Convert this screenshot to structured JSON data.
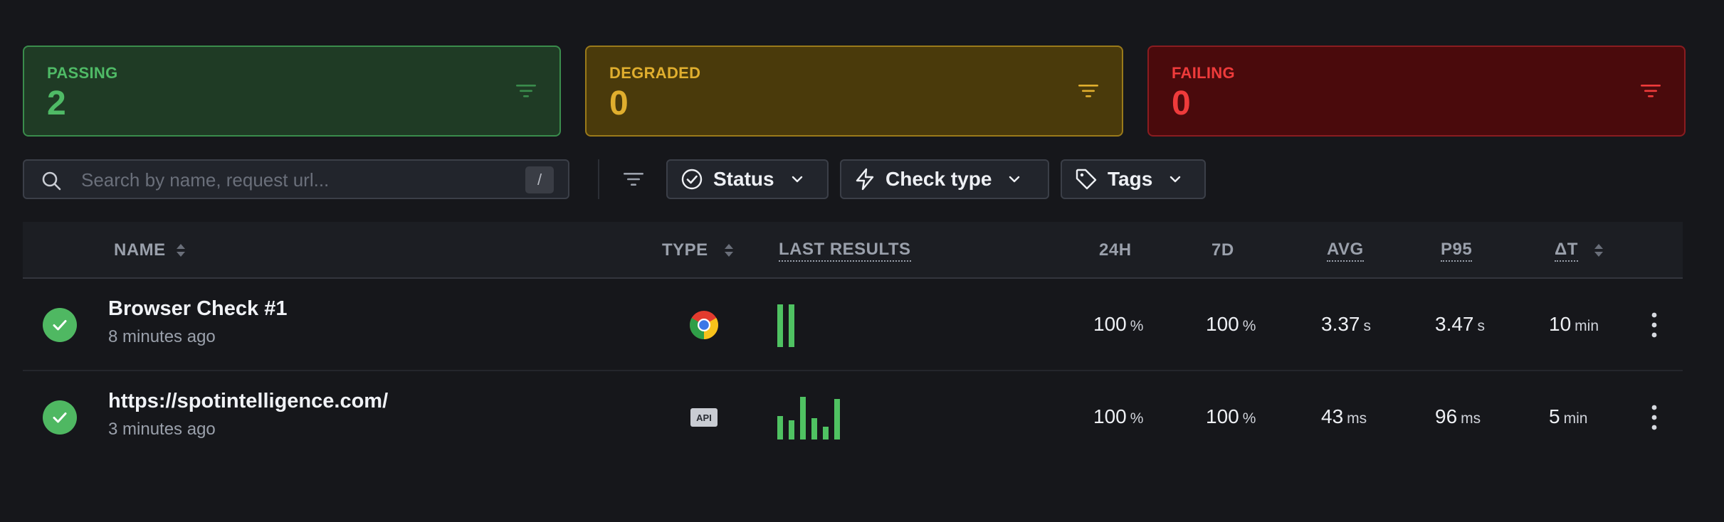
{
  "summary": {
    "passing": {
      "label": "PASSING",
      "count": "2"
    },
    "degraded": {
      "label": "DEGRADED",
      "count": "0"
    },
    "failing": {
      "label": "FAILING",
      "count": "0"
    }
  },
  "toolbar": {
    "search_placeholder": "Search by name, request url...",
    "search_shortcut": "/",
    "status_label": "Status",
    "check_type_label": "Check type",
    "tags_label": "Tags"
  },
  "table": {
    "headers": {
      "name": "NAME",
      "type": "TYPE",
      "last_results": "LAST RESULTS",
      "h24": "24H",
      "d7": "7D",
      "avg": "AVG",
      "p95": "P95",
      "dt": "ΔT"
    },
    "rows": [
      {
        "name": "Browser Check #1",
        "ago": "8 minutes ago",
        "type_icon": "chrome-icon",
        "last_results": [
          1,
          1
        ],
        "h24": "100",
        "h24_unit": "%",
        "d7": "100",
        "d7_unit": "%",
        "avg": "3.37",
        "avg_unit": "s",
        "p95": "3.47",
        "p95_unit": "s",
        "dt": "10",
        "dt_unit": "min"
      },
      {
        "name": "https://spotintelligence.com/",
        "ago": "3 minutes ago",
        "type_icon": "api-icon",
        "type_text": "API",
        "last_results": [
          0.55,
          0.45,
          1,
          0.5,
          0.3,
          0.95
        ],
        "h24": "100",
        "h24_unit": "%",
        "d7": "100",
        "d7_unit": "%",
        "avg": "43",
        "avg_unit": "ms",
        "p95": "96",
        "p95_unit": "ms",
        "dt": "5",
        "dt_unit": "min"
      }
    ]
  },
  "colors": {
    "passing": "#4fba66",
    "degraded": "#e0ae2e",
    "failing": "#ef3b3b",
    "bar": "#4fc262"
  }
}
